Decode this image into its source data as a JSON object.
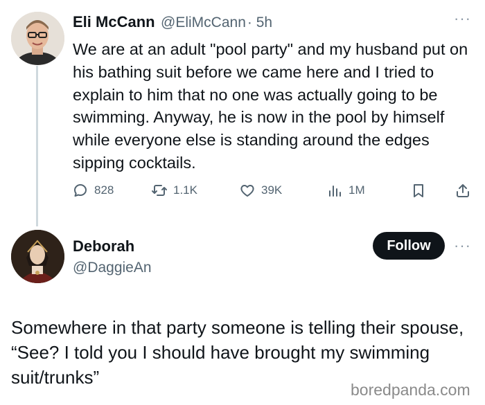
{
  "tweet": {
    "author_name": "Eli McCann",
    "author_handle": "@EliMcCann",
    "time": "· 5h",
    "more_icon": "more-horizontal-icon",
    "text": "We are at an adult \"pool party\" and my husband put on his bathing suit before we came here and I tried to explain to him that no one was actually going to be swimming. Anyway, he is now in the pool by himself while everyone else is standing around the edges sipping cocktails.",
    "actions": {
      "replies": "828",
      "retweets": "1.1K",
      "likes": "39K",
      "views": "1M"
    }
  },
  "reply": {
    "author_name": "Deborah",
    "author_handle": "@DaggieAn",
    "follow_label": "Follow",
    "text": "Somewhere in that party someone is telling their spouse, “See?  I told you I should have brought my swimming suit/trunks”"
  },
  "watermark": "boredpanda.com",
  "colors": {
    "text": "#0f1419",
    "secondary": "#536471",
    "thread_line": "#cfd9de",
    "follow_bg": "#0f1419"
  }
}
